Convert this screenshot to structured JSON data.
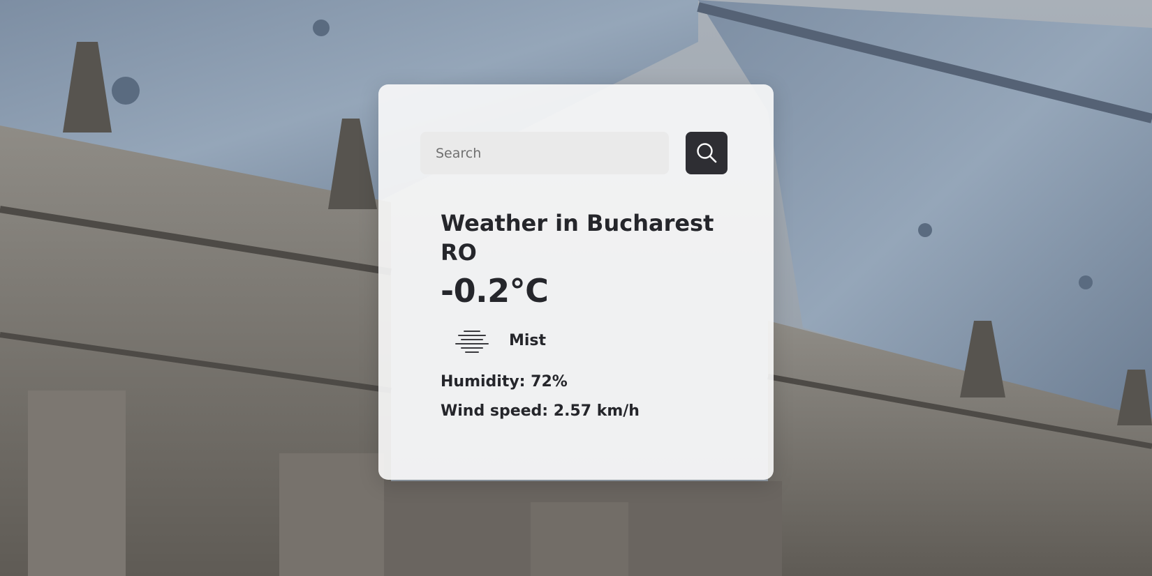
{
  "search": {
    "placeholder": "Search",
    "value": "",
    "button_icon": "search-icon"
  },
  "weather": {
    "city_line": "Weather in Bucharest RO",
    "temperature": "-0.2°C",
    "condition": "Mist",
    "condition_icon": "mist-icon",
    "humidity": "Humidity: 72%",
    "wind_speed": "Wind speed: 2.57 km/h"
  },
  "colors": {
    "card_background": "#fafafa",
    "text": "#25262b",
    "button_background": "#2e2e33",
    "input_background": "#eaeaea"
  }
}
